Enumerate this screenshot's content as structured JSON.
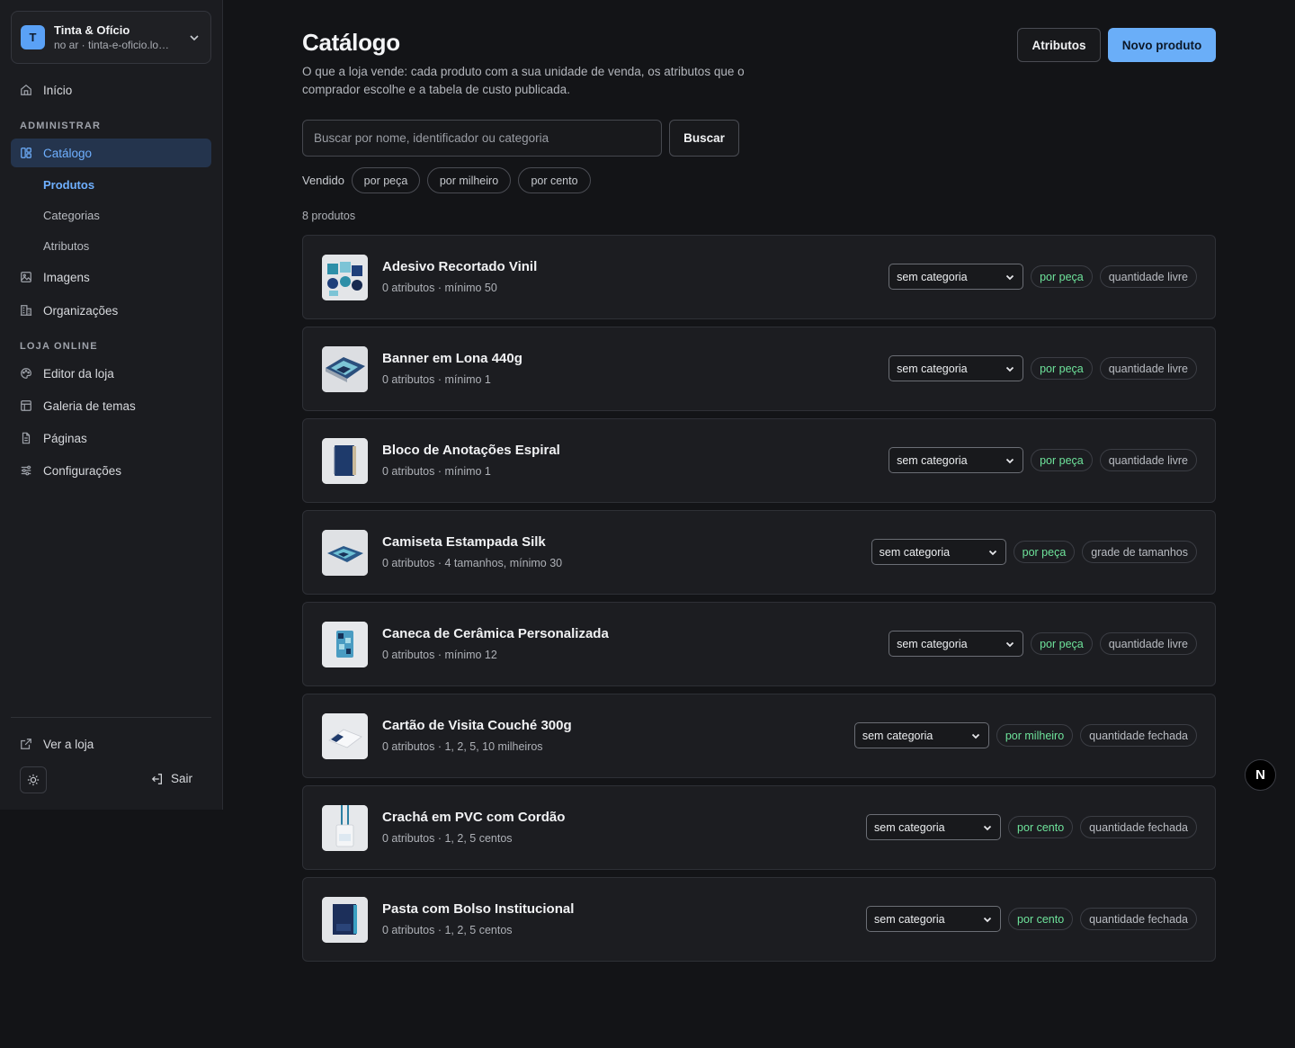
{
  "org": {
    "avatar_letter": "T",
    "name": "Tinta & Ofício",
    "subtitle": "no ar · tinta-e-oficio.lo…"
  },
  "nav": {
    "home": "Início",
    "section_admin": "ADMINISTRAR",
    "catalog": "Catálogo",
    "catalog_sub": [
      "Produtos",
      "Categorias",
      "Atributos"
    ],
    "images": "Imagens",
    "organizations": "Organizações",
    "section_store": "LOJA ONLINE",
    "store_editor": "Editor da loja",
    "theme_gallery": "Galeria de temas",
    "pages": "Páginas",
    "settings": "Configurações",
    "view_store": "Ver a loja",
    "logout": "Sair"
  },
  "header": {
    "title": "Catálogo",
    "description": "O que a loja vende: cada produto com a sua unidade de venda, os atributos que o comprador escolhe e a tabela de custo publicada.",
    "attributes_button": "Atributos",
    "new_product_button": "Novo produto"
  },
  "search": {
    "placeholder": "Buscar por nome, identificador ou categoria",
    "value": "",
    "button": "Buscar"
  },
  "filters": {
    "label": "Vendido",
    "chips": [
      "por peça",
      "por milheiro",
      "por cento"
    ]
  },
  "product_count": "8 produtos",
  "products": [
    {
      "name": "Adesivo Recortado Vinil",
      "meta": "0 atributos · mínimo 50",
      "category": "sem categoria",
      "unit": "por peça",
      "quantity": "quantidade livre"
    },
    {
      "name": "Banner em Lona 440g",
      "meta": "0 atributos · mínimo 1",
      "category": "sem categoria",
      "unit": "por peça",
      "quantity": "quantidade livre"
    },
    {
      "name": "Bloco de Anotações Espiral",
      "meta": "0 atributos · mínimo 1",
      "category": "sem categoria",
      "unit": "por peça",
      "quantity": "quantidade livre"
    },
    {
      "name": "Camiseta Estampada Silk",
      "meta": "0 atributos · 4 tamanhos, mínimo 30",
      "category": "sem categoria",
      "unit": "por peça",
      "quantity": "grade de tamanhos"
    },
    {
      "name": "Caneca de Cerâmica Personalizada",
      "meta": "0 atributos · mínimo 12",
      "category": "sem categoria",
      "unit": "por peça",
      "quantity": "quantidade livre"
    },
    {
      "name": "Cartão de Visita Couché 300g",
      "meta": "0 atributos · 1, 2, 5, 10 milheiros",
      "category": "sem categoria",
      "unit": "por milheiro",
      "quantity": "quantidade fechada"
    },
    {
      "name": "Crachá em PVC com Cordão",
      "meta": "0 atributos · 1, 2, 5 centos",
      "category": "sem categoria",
      "unit": "por cento",
      "quantity": "quantidade fechada"
    },
    {
      "name": "Pasta com Bolso Institucional",
      "meta": "0 atributos · 1, 2, 5 centos",
      "category": "sem categoria",
      "unit": "por cento",
      "quantity": "quantidade fechada"
    }
  ],
  "dev_badge": "N",
  "colors": {
    "accent": "#6aaef8",
    "active_nav_bg": "#24344d",
    "unit_badge_text": "#6ee39b",
    "background": "#131417"
  },
  "icons": {
    "home": "home-icon",
    "catalog": "layout-grid-icon",
    "images": "image-icon",
    "organizations": "building-icon",
    "store_editor": "palette-icon",
    "theme_gallery": "layout-icon",
    "pages": "file-icon",
    "settings": "sliders-icon",
    "view_store": "external-link-icon",
    "theme": "sun-icon",
    "logout": "log-out-icon"
  }
}
